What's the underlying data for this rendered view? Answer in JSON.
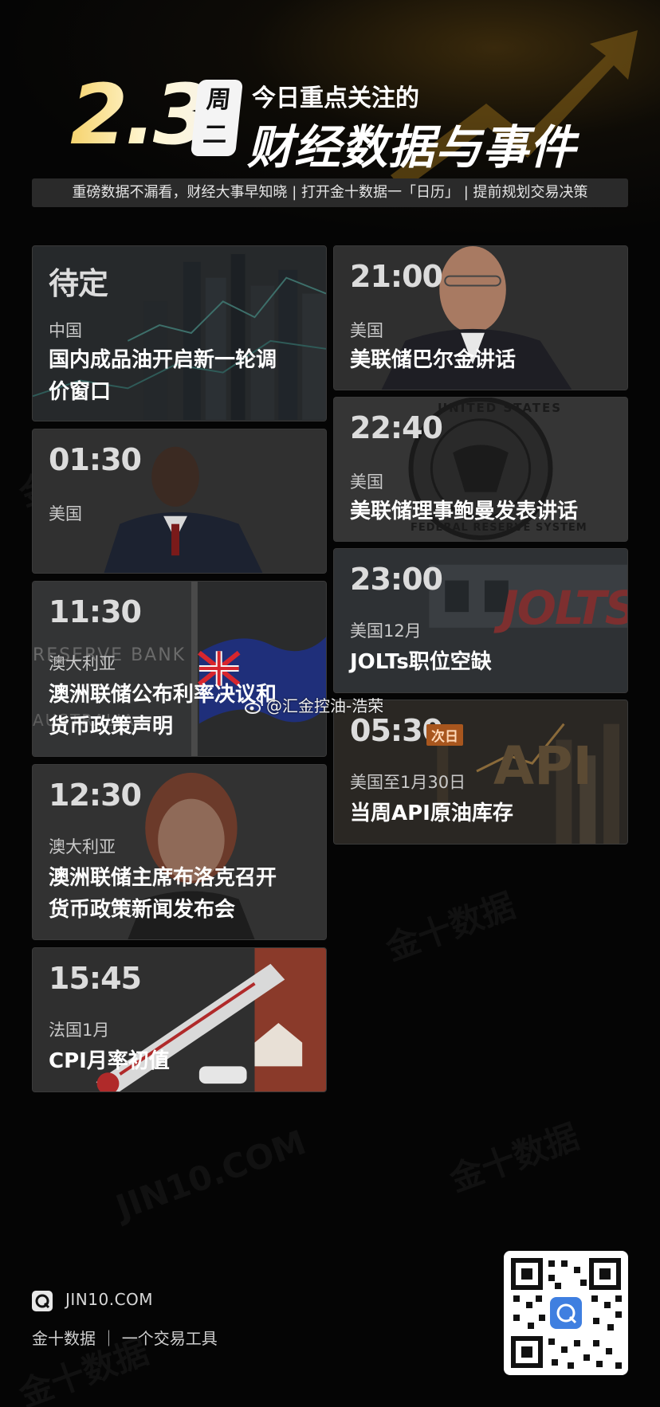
{
  "header": {
    "date": "2.3",
    "weekday_chars": [
      "周",
      "二"
    ],
    "title_line1": "今日重点关注的",
    "title_line2": "财经数据与事件",
    "tagline": "重磅数据不漏看，财经大事早知晓 | 打开金十数据一「日历」 | 提前规划交易决策"
  },
  "left_cards": [
    {
      "time": "待定",
      "region": "中国",
      "event_lines": [
        "国内成品油开启新一轮调",
        "价窗口"
      ]
    },
    {
      "time": "01:30",
      "region": "美国",
      "event_lines": []
    },
    {
      "time": "11:30",
      "region": "澳大利亚",
      "event_lines": [
        "澳洲联储公布利率决议和",
        "货币政策声明"
      ]
    },
    {
      "time": "12:30",
      "region": "澳大利亚",
      "event_lines": [
        "澳洲联储主席布洛克召开",
        "货币政策新闻发布会"
      ]
    },
    {
      "time": "15:45",
      "region": "法国1月",
      "event_lines": [
        "CPI月率初值"
      ]
    }
  ],
  "right_cards": [
    {
      "time": "21:00",
      "region": "美国",
      "event_lines": [
        "美联储巴尔金讲话"
      ]
    },
    {
      "time": "22:40",
      "region": "美国",
      "event_lines": [
        "美联储理事鲍曼发表讲话"
      ]
    },
    {
      "time": "23:00",
      "region": "美国12月",
      "event_lines": [
        "JOLTs职位空缺"
      ]
    },
    {
      "time": "05:30",
      "badge": "次日",
      "region": "美国至1月30日",
      "event_lines": [
        "当周API原油库存"
      ]
    }
  ],
  "image_text": {
    "bank_sign": "RESERVE BANK",
    "bank_sign2": "AUSTRALIA",
    "jolts_sign": "JOLTS",
    "api_sign": "API",
    "fed_seal_top": "UNITED STATES",
    "fed_seal_bottom": "FEDERAL RESERVE SYSTEM"
  },
  "weibo_mark": "@汇金控油-浩荣",
  "watermark": [
    "金十数据",
    "JIN10.COM"
  ],
  "footer": {
    "url": "JIN10.COM",
    "brand": "金十数据 ｜ 一个交易工具"
  },
  "colors": {
    "background": "#050505",
    "card": "#2d2d2d",
    "date_gold": "#f6d36d",
    "badge": "#a8561e"
  },
  "icons": [
    "jin10-logo-icon",
    "weibo-icon",
    "qr-code",
    "arrow-chart-icon"
  ]
}
